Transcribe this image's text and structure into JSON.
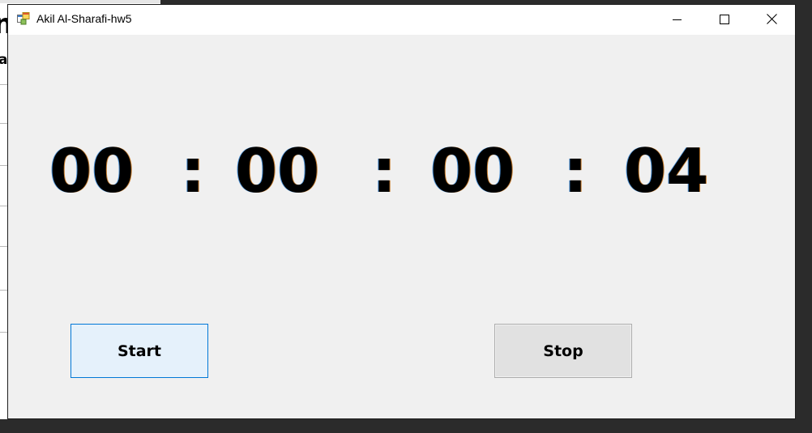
{
  "background_app": {
    "visible_char_large": "n",
    "visible_char_small": "a"
  },
  "window": {
    "title": "Akil Al-Sharafi-hw5",
    "icon": "winforms-app-icon",
    "controls": {
      "minimize_icon": "minimize-icon",
      "maximize_icon": "maximize-icon",
      "close_icon": "close-icon"
    }
  },
  "timer": {
    "hours": "00",
    "minutes": "00",
    "seconds": "00",
    "ticks": "04",
    "separator": ":"
  },
  "buttons": {
    "start_label": "Start",
    "stop_label": "Stop"
  },
  "colors": {
    "form_background": "#f0f0f0",
    "focused_button_border": "#0078d7",
    "button_border": "#adadad"
  }
}
